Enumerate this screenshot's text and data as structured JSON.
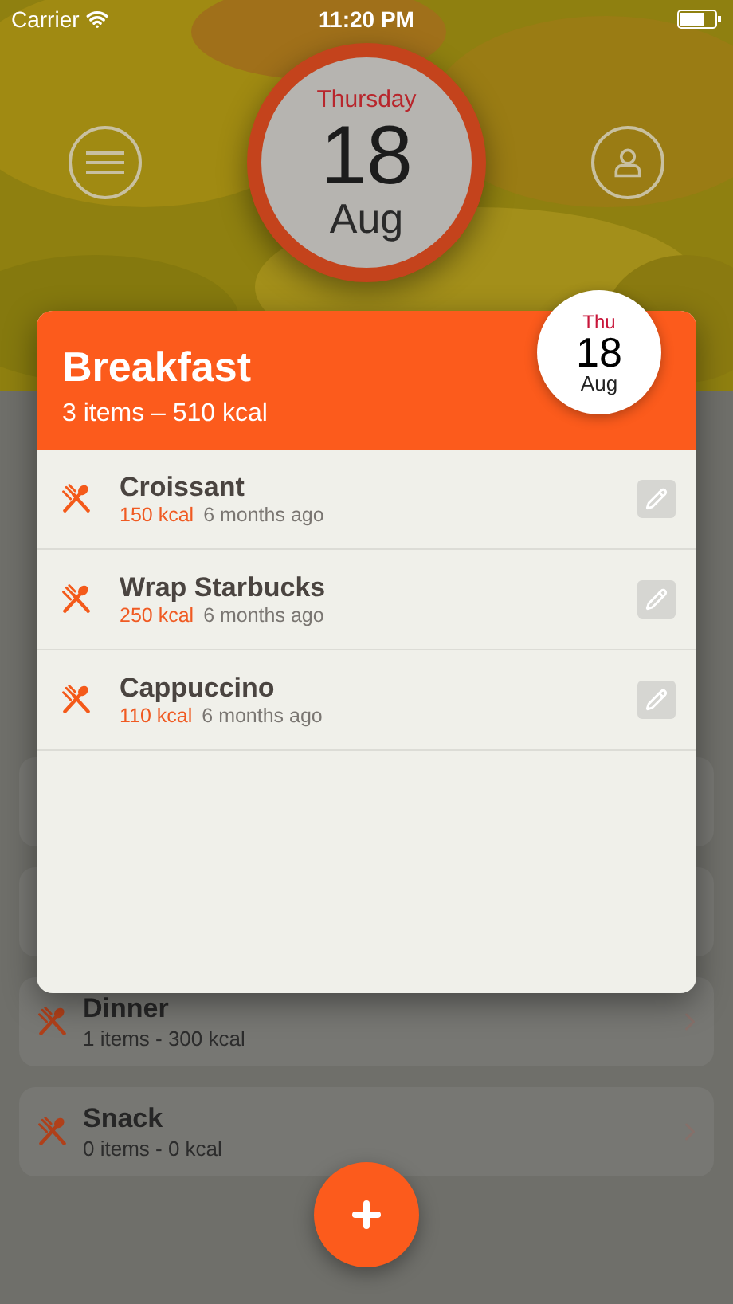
{
  "status_bar": {
    "carrier": "Carrier",
    "time": "11:20 PM"
  },
  "header": {
    "day": "Thursday",
    "date": "18",
    "month": "Aug"
  },
  "meals": [
    {
      "name": "Dinner",
      "summary": "1 items - 300 kcal"
    },
    {
      "name": "Snack",
      "summary": "0 items - 0 kcal"
    }
  ],
  "popup": {
    "title": "Breakfast",
    "summary": "3 items – 510 kcal",
    "date_badge": {
      "day": "Thu",
      "date": "18",
      "month": "Aug"
    },
    "items": [
      {
        "name": "Croissant",
        "kcal": "150 kcal",
        "time": "6 months ago"
      },
      {
        "name": "Wrap Starbucks",
        "kcal": "250 kcal",
        "time": "6 months ago"
      },
      {
        "name": "Cappuccino",
        "kcal": "110 kcal",
        "time": "6 months ago"
      }
    ]
  }
}
